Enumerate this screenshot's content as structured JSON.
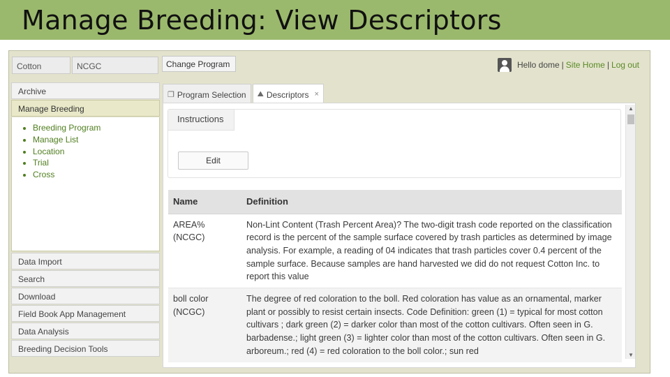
{
  "slide": {
    "title": "Manage Breeding: View Descriptors"
  },
  "topbar": {
    "crop": "Cotton",
    "program": "NCGC",
    "change_program": "Change Program",
    "greeting": "Hello dome",
    "site_home": "Site Home",
    "logout": "Log out",
    "separator": "|"
  },
  "sidebar": {
    "archive": "Archive",
    "manage_breeding": "Manage Breeding",
    "submenu": [
      "Breeding Program",
      "Manage List",
      "Location",
      "Trial",
      "Cross"
    ],
    "items": [
      "Data Import",
      "Search",
      "Download",
      "Field Book App Management",
      "Data Analysis",
      "Breeding Decision Tools"
    ]
  },
  "tabs": [
    {
      "label": "Program Selection",
      "icon": "window-icon"
    },
    {
      "label": "Descriptors",
      "icon": "descriptors-icon",
      "close": "×"
    }
  ],
  "instructions": {
    "tab_label": "Instructions",
    "edit_label": "Edit"
  },
  "table": {
    "headers": {
      "name": "Name",
      "definition": "Definition"
    },
    "rows": [
      {
        "name": "AREA% (NCGC)",
        "definition": "Non-Lint Content (Trash Percent Area)? The two-digit trash code reported on the classification record is the percent of the sample surface covered by trash particles as determined by image analysis. For example, a reading of 04 indicates that trash particles cover 0.4 percent of the sample surface. Because samples are hand harvested we did do not request Cotton Inc. to report this value"
      },
      {
        "name": "boll color (NCGC)",
        "definition": "The degree of red coloration to the boll. Red coloration has value as an ornamental, marker plant or possibly to resist certain insects. Code Definition: green (1) = typical for most cotton cultivars ; dark green (2) = darker color than most of the cotton cultivars. Often seen in G. barbadense.; light green (3) = lighter color than most of the cotton cultivars. Often seen in G. arboreum.; red (4) = red coloration to the boll color.; sun red"
      }
    ]
  },
  "scrollbar": {
    "up": "▲",
    "down": "▼"
  }
}
